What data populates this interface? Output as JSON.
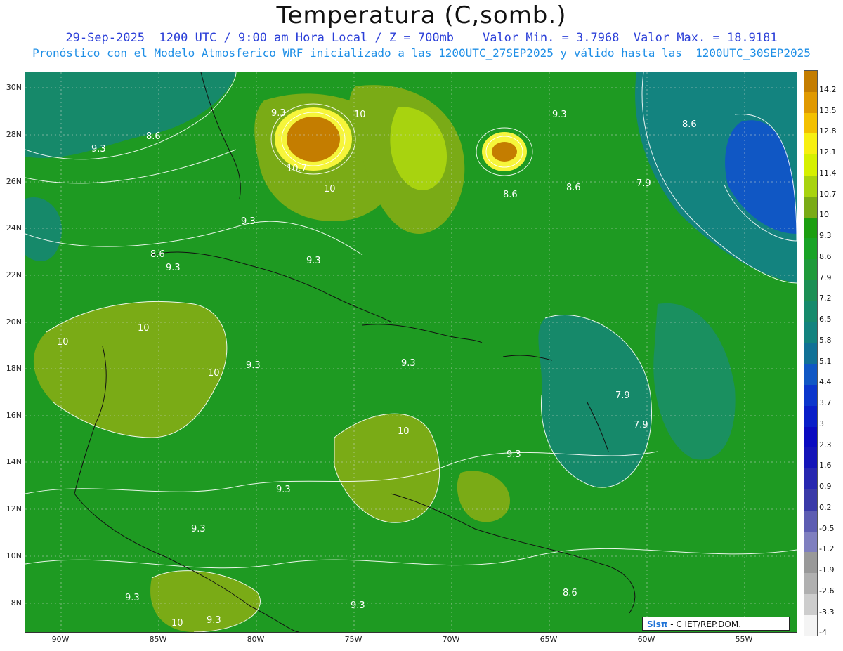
{
  "header": {
    "title": "Temperatura (C,somb.)",
    "line1": "29-Sep-2025  1200 UTC / 9:00 am Hora Local / Z = 700mb    Valor Min. = 3.7968  Valor Max. = 18.9181",
    "line2": "Pronóstico con el Modelo Atmosferico WRF inicializado a las 1200UTC_27SEP2025 y válido hasta las  1200UTC_30SEP2025"
  },
  "map": {
    "lat_labels": [
      "30N",
      "28N",
      "26N",
      "24N",
      "22N",
      "20N",
      "18N",
      "16N",
      "14N",
      "12N",
      "10N",
      "8N"
    ],
    "lon_labels": [
      "90W",
      "85W",
      "80W",
      "75W",
      "70W",
      "65W",
      "60W",
      "55W"
    ],
    "contour_labels": [
      "9.3",
      "10",
      "8.6",
      "9.3",
      "10.7",
      "10",
      "9.3",
      "8.6",
      "9.3",
      "9.3",
      "10",
      "10",
      "9.3",
      "9.3",
      "10",
      "10",
      "9.3",
      "9.3",
      "9.3",
      "9.3",
      "10",
      "9.3",
      "9.3",
      "9.3",
      "8.6",
      "8.6",
      "7.9",
      "8.6",
      "7.9",
      "7.9",
      "8.6"
    ],
    "colors": {
      "sea_green": "#1e9a22",
      "warm_green": "#7aab16",
      "light_green": "#a8d30f",
      "cool_teal": "#16896a",
      "blue": "#1057c4",
      "hot_orange": "#c47d00",
      "yellow": "#f6f53a",
      "contour": "#ffffff"
    }
  },
  "colorbar": {
    "labels": [
      "14.2",
      "13.5",
      "12.8",
      "12.1",
      "11.4",
      "10.7",
      "10",
      "9.3",
      "8.6",
      "7.9",
      "7.2",
      "6.5",
      "5.8",
      "5.1",
      "4.4",
      "3.7",
      "3",
      "2.3",
      "1.6",
      "0.9",
      "0.2",
      "-0.5",
      "-1.2",
      "-1.9",
      "-2.6",
      "-3.3",
      "-4"
    ],
    "colors": [
      "#c47d00",
      "#e09900",
      "#f3c000",
      "#f7ef11",
      "#d6f000",
      "#a8d30f",
      "#7aab16",
      "#1c9e10",
      "#19a326",
      "#1f9a3a",
      "#1c8f55",
      "#168a6c",
      "#13837f",
      "#117196",
      "#1057c4",
      "#0b36cc",
      "#091ec8",
      "#0a0ac0",
      "#1414b8",
      "#2727b0",
      "#3a3aa8",
      "#5d5db2",
      "#7f7fbf",
      "#999999",
      "#b0b0b0",
      "#cdcdcd",
      "#f4f4f4"
    ]
  },
  "credit": {
    "brand": "Sisπ",
    "rest": "- C    IET/REP.DOM."
  }
}
